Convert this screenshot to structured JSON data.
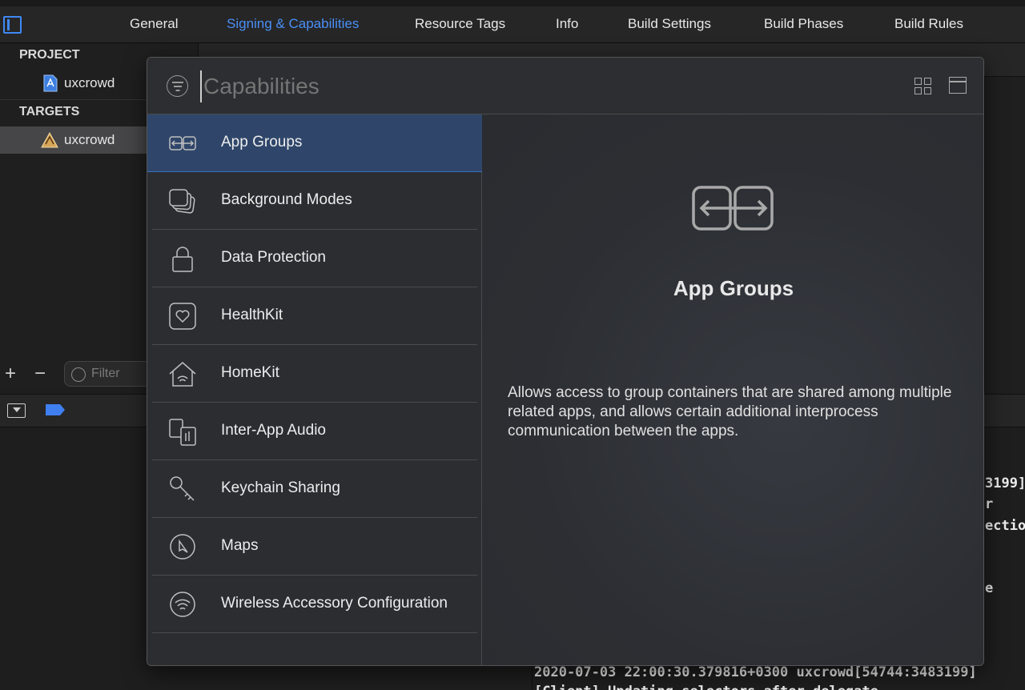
{
  "tabs": [
    "General",
    "Signing & Capabilities",
    "Resource Tags",
    "Info",
    "Build Settings",
    "Build Phases",
    "Build Rules"
  ],
  "active_tab": "Signing & Capabilities",
  "sidebar": {
    "project_header": "PROJECT",
    "project_item": "uxcrowd",
    "targets_header": "TARGETS",
    "target_item": "uxcrowd",
    "filter_placeholder": "Filter"
  },
  "popover": {
    "search_placeholder": "Capabilities",
    "items": [
      {
        "label": "App Groups",
        "icon": "app-groups-icon"
      },
      {
        "label": "Background Modes",
        "icon": "background-modes-icon"
      },
      {
        "label": "Data Protection",
        "icon": "lock-icon"
      },
      {
        "label": "HealthKit",
        "icon": "heart-icon"
      },
      {
        "label": "HomeKit",
        "icon": "home-icon"
      },
      {
        "label": "Inter-App Audio",
        "icon": "inter-app-audio-icon"
      },
      {
        "label": "Keychain Sharing",
        "icon": "key-icon"
      },
      {
        "label": "Maps",
        "icon": "compass-icon"
      },
      {
        "label": "Wireless Accessory Configuration",
        "icon": "wireless-icon"
      }
    ],
    "selected": "App Groups",
    "detail": {
      "title": "App Groups",
      "description": "Allows access to group containers that are shared among multiple related apps, and allows certain additional interprocess communication between the apps."
    }
  },
  "console": {
    "fragments": [
      "3199]",
      "r",
      "ectio",
      "e"
    ],
    "log_line": "2020-07-03 22:00:30.379816+0300 uxcrowd[54744:3483199]",
    "log_line_2": "   [Client] Updating selectors after delegate..."
  },
  "colors": {
    "accent": "#3f89f5",
    "selection": "#2f466a",
    "popover_bg": "#2b2d31"
  }
}
